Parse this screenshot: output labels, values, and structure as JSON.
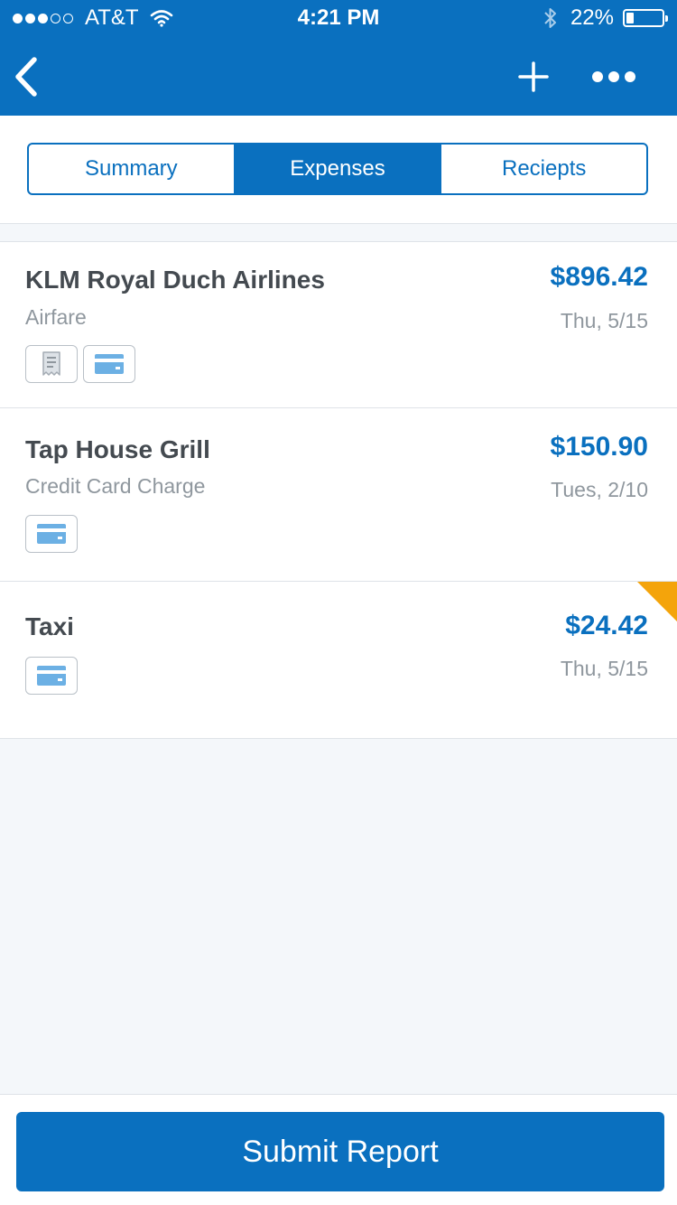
{
  "status_bar": {
    "carrier": "AT&T",
    "time": "4:21 PM",
    "battery": "22%",
    "battery_level": 0.22
  },
  "tabs": [
    {
      "label": "Summary",
      "active": false
    },
    {
      "label": "Expenses",
      "active": true
    },
    {
      "label": "Reciepts",
      "active": false
    }
  ],
  "expenses": [
    {
      "merchant": "KLM Royal Duch Airlines",
      "category": "Airfare",
      "amount": "$896.42",
      "date": "Thu, 5/15",
      "icons": [
        "receipt-icon",
        "credit-card-icon"
      ],
      "flagged": false
    },
    {
      "merchant": "Tap House Grill",
      "category": "Credit Card Charge",
      "amount": "$150.90",
      "date": "Tues, 2/10",
      "icons": [
        "credit-card-icon"
      ],
      "flagged": false
    },
    {
      "merchant": "Taxi",
      "category": "",
      "amount": "$24.42",
      "date": "Thu, 5/15",
      "icons": [
        "credit-card-icon"
      ],
      "flagged": true
    }
  ],
  "submit_label": "Submit Report",
  "colors": {
    "brand": "#0a70bf",
    "flag": "#f4a40b",
    "card": "#6cb0e4"
  }
}
